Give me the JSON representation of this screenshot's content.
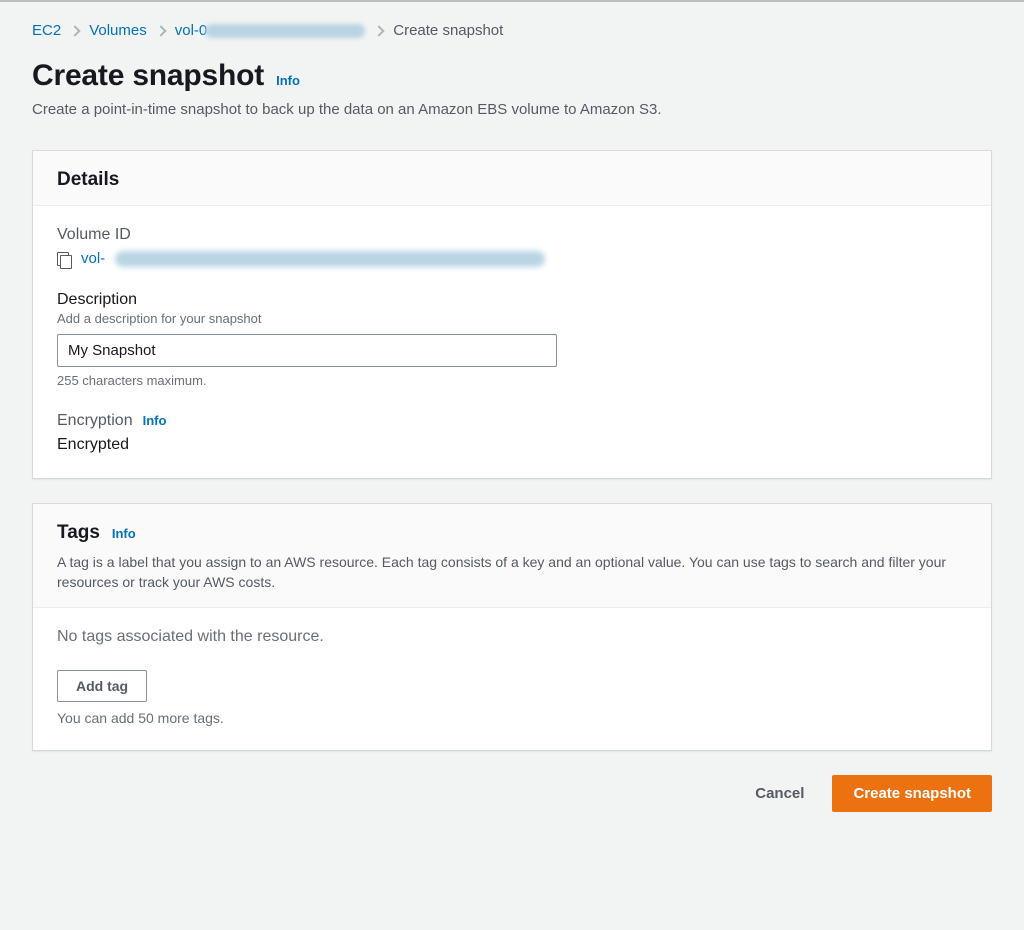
{
  "breadcrumb": {
    "ec2": "EC2",
    "volumes": "Volumes",
    "vol_prefix": "vol-0",
    "current": "Create snapshot"
  },
  "page": {
    "title": "Create snapshot",
    "info": "Info",
    "description": "Create a point-in-time snapshot to back up the data on an Amazon EBS volume to Amazon S3."
  },
  "details": {
    "title": "Details",
    "volume_id_label": "Volume ID",
    "volume_link_prefix": "vol-",
    "description_label": "Description",
    "description_hint": "Add a description for your snapshot",
    "description_value": "My Snapshot",
    "description_max": "255 characters maximum.",
    "encryption_label": "Encryption",
    "encryption_info": "Info",
    "encryption_value": "Encrypted"
  },
  "tags": {
    "title": "Tags",
    "info": "Info",
    "description": "A tag is a label that you assign to an AWS resource. Each tag consists of a key and an optional value. You can use tags to search and filter your resources or track your AWS costs.",
    "empty": "No tags associated with the resource.",
    "add_tag": "Add tag",
    "limit_hint": "You can add 50 more tags."
  },
  "actions": {
    "cancel": "Cancel",
    "create": "Create snapshot"
  }
}
